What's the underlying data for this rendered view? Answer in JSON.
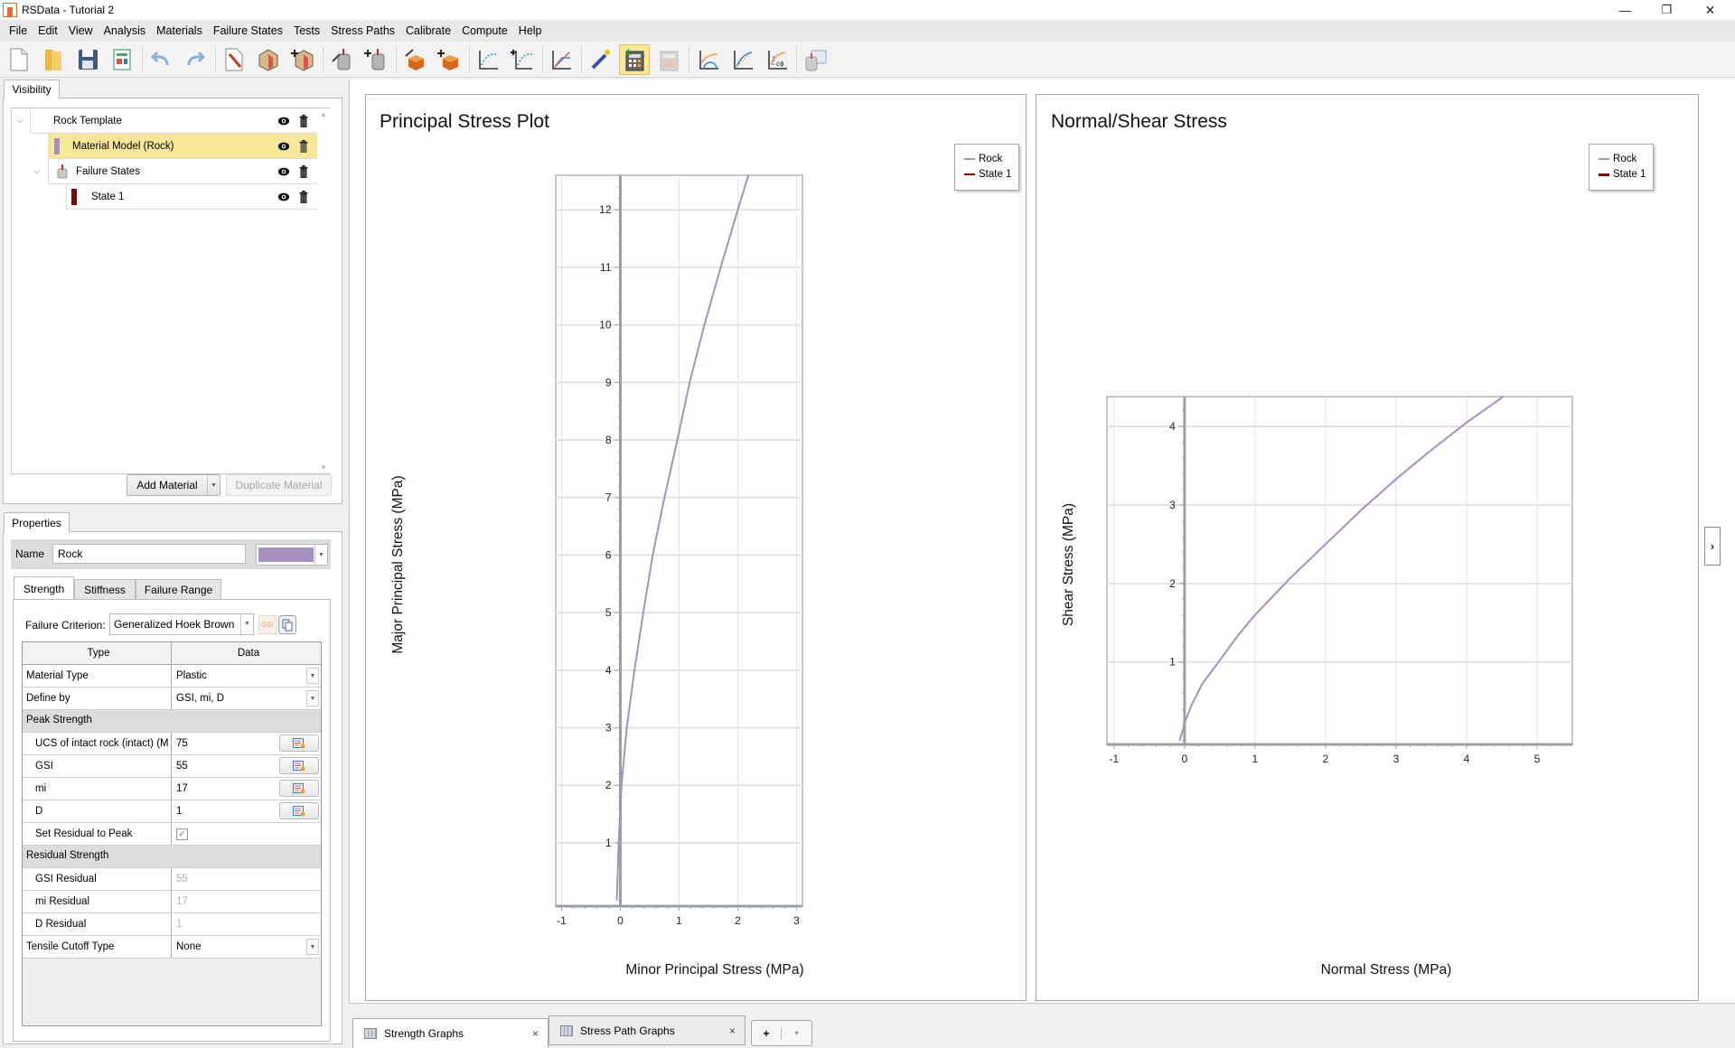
{
  "window": {
    "title": "RSData - Tutorial 2",
    "controls": {
      "minimize": "—",
      "restore": "❐",
      "close": "✕"
    }
  },
  "menu": [
    "File",
    "Edit",
    "View",
    "Analysis",
    "Materials",
    "Failure States",
    "Tests",
    "Stress Paths",
    "Calibrate",
    "Compute",
    "Help"
  ],
  "toolbar": {
    "buttons": [
      {
        "icon": "new-file-icon"
      },
      {
        "icon": "open-folder-icon"
      },
      {
        "icon": "save-icon"
      },
      {
        "icon": "report-icon"
      },
      {
        "icon": "undo-icon"
      },
      {
        "icon": "redo-icon"
      },
      {
        "icon": "project-settings-icon"
      },
      {
        "icon": "edit-material-icon"
      },
      {
        "icon": "add-material-icon"
      },
      {
        "icon": "edit-failure-state-icon"
      },
      {
        "icon": "add-failure-state-icon"
      },
      {
        "icon": "edit-test-icon"
      },
      {
        "icon": "add-test-icon"
      },
      {
        "icon": "edit-stress-path-icon"
      },
      {
        "icon": "add-stress-path-icon"
      },
      {
        "icon": "edit-calibration-icon"
      },
      {
        "icon": "magic-wand-icon"
      },
      {
        "icon": "calculator-icon",
        "active": true
      },
      {
        "icon": "calculator-disabled-icon"
      },
      {
        "icon": "mohr-circle-plot-icon"
      },
      {
        "icon": "strength-envelope-plot-icon"
      },
      {
        "icon": "c-phi-plot-icon"
      },
      {
        "icon": "export-data-icon"
      }
    ]
  },
  "visibility": {
    "tab_label": "Visibility",
    "tree": [
      {
        "label": "Rock Template",
        "level": 0,
        "expanded": true
      },
      {
        "label": "Material Model (Rock)",
        "level": 1,
        "selected": true,
        "color": "#a78fc2"
      },
      {
        "label": "Failure States",
        "level": 1,
        "expanded": true
      },
      {
        "label": "State 1",
        "level": 2,
        "color": "#7a0a0a"
      }
    ],
    "add_material": "Add Material",
    "duplicate_material": "Duplicate Material"
  },
  "properties": {
    "tab_label": "Properties",
    "name_label": "Name",
    "name_value": "Rock",
    "material_color": "#a78fc2",
    "subtabs": [
      "Strength",
      "Stiffness",
      "Failure Range"
    ],
    "active_subtab": "Strength",
    "failure_criterion_label": "Failure Criterion:",
    "failure_criterion_value": "Generalized Hoek Brown",
    "grid": {
      "headers": [
        "Type",
        "Data"
      ],
      "rows": [
        {
          "type": "Material Type",
          "data": "Plastic",
          "kind": "dropdown"
        },
        {
          "type": "Define by",
          "data": "GSI, mi, D",
          "kind": "dropdown"
        },
        {
          "type": "Peak Strength",
          "kind": "group"
        },
        {
          "type": "UCS of intact rock (intact) (M",
          "data": "75",
          "kind": "button",
          "indent": true
        },
        {
          "type": "GSI",
          "data": "55",
          "kind": "button",
          "indent": true
        },
        {
          "type": "mi",
          "data": "17",
          "kind": "button",
          "indent": true
        },
        {
          "type": "D",
          "data": "1",
          "kind": "button",
          "indent": true
        },
        {
          "type": "Set Residual to Peak",
          "data": "✓",
          "kind": "checkbox",
          "indent": true
        },
        {
          "type": "Residual Strength",
          "kind": "group"
        },
        {
          "type": "GSI Residual",
          "data": "55",
          "kind": "muted",
          "indent": true
        },
        {
          "type": "mi Residual",
          "data": "17",
          "kind": "muted",
          "indent": true
        },
        {
          "type": "D Residual",
          "data": "1",
          "kind": "muted",
          "indent": true
        },
        {
          "type": "Tensile Cutoff Type",
          "data": "None",
          "kind": "dropdown"
        }
      ]
    }
  },
  "chart_data": [
    {
      "type": "line",
      "title": "Principal Stress Plot",
      "xlabel": "Minor Principal Stress (MPa)",
      "ylabel": "Major Principal Stress (MPa)",
      "xlim": [
        -1.1,
        3.1
      ],
      "ylim": [
        -0.1,
        12.6
      ],
      "xticks": [
        -1,
        0,
        1,
        2,
        3
      ],
      "yticks": [
        1,
        2,
        3,
        4,
        5,
        6,
        7,
        8,
        9,
        10,
        11,
        12
      ],
      "grid": true,
      "legend": {
        "position": "top-right",
        "entries": [
          {
            "name": "Rock",
            "color": "#a78fc2"
          },
          {
            "name": "State 1",
            "color": "#7a0a0a"
          }
        ]
      },
      "series": [
        {
          "name": "Rock",
          "color": "#a78fc2",
          "x": [
            -0.06,
            -0.03,
            0.02,
            0.11,
            0.24,
            0.39,
            0.55,
            0.75,
            0.97,
            1.18,
            1.43,
            1.71,
            2.0,
            2.18
          ],
          "y": [
            0,
            1,
            2,
            3,
            4,
            5,
            6,
            7,
            8,
            9,
            10,
            11,
            12,
            12.6
          ]
        }
      ]
    },
    {
      "type": "line",
      "title": "Normal/Shear Stress",
      "xlabel": "Normal Stress (MPa)",
      "ylabel": "Shear Stress (MPa)",
      "xlim": [
        -1.1,
        5.5
      ],
      "ylim": [
        -0.05,
        4.38
      ],
      "xticks": [
        -1,
        0,
        1,
        2,
        3,
        4,
        5
      ],
      "yticks": [
        1,
        2,
        3,
        4
      ],
      "grid": true,
      "legend": {
        "position": "top-right",
        "entries": [
          {
            "name": "Rock",
            "color": "#a78fc2"
          },
          {
            "name": "State 1",
            "color": "#7a0a0a"
          }
        ]
      },
      "series": [
        {
          "name": "Rock",
          "color": "#a78fc2",
          "x": [
            -0.07,
            -0.02,
            0.0,
            0.1,
            0.25,
            0.5,
            0.75,
            1.0,
            1.5,
            2.0,
            2.5,
            3.0,
            3.5,
            4.0,
            4.52
          ],
          "y": [
            0,
            0.15,
            0.22,
            0.45,
            0.72,
            1.02,
            1.33,
            1.6,
            2.07,
            2.5,
            2.93,
            3.33,
            3.7,
            4.05,
            4.38
          ]
        }
      ]
    }
  ],
  "bottom_tabs": [
    {
      "label": "Strength Graphs",
      "active": true
    },
    {
      "label": "Stress Path Graphs",
      "active": false
    }
  ],
  "bottom_controls": {
    "add": "+",
    "dropdown": "▾",
    "close": "×"
  },
  "side_toggle": "›"
}
